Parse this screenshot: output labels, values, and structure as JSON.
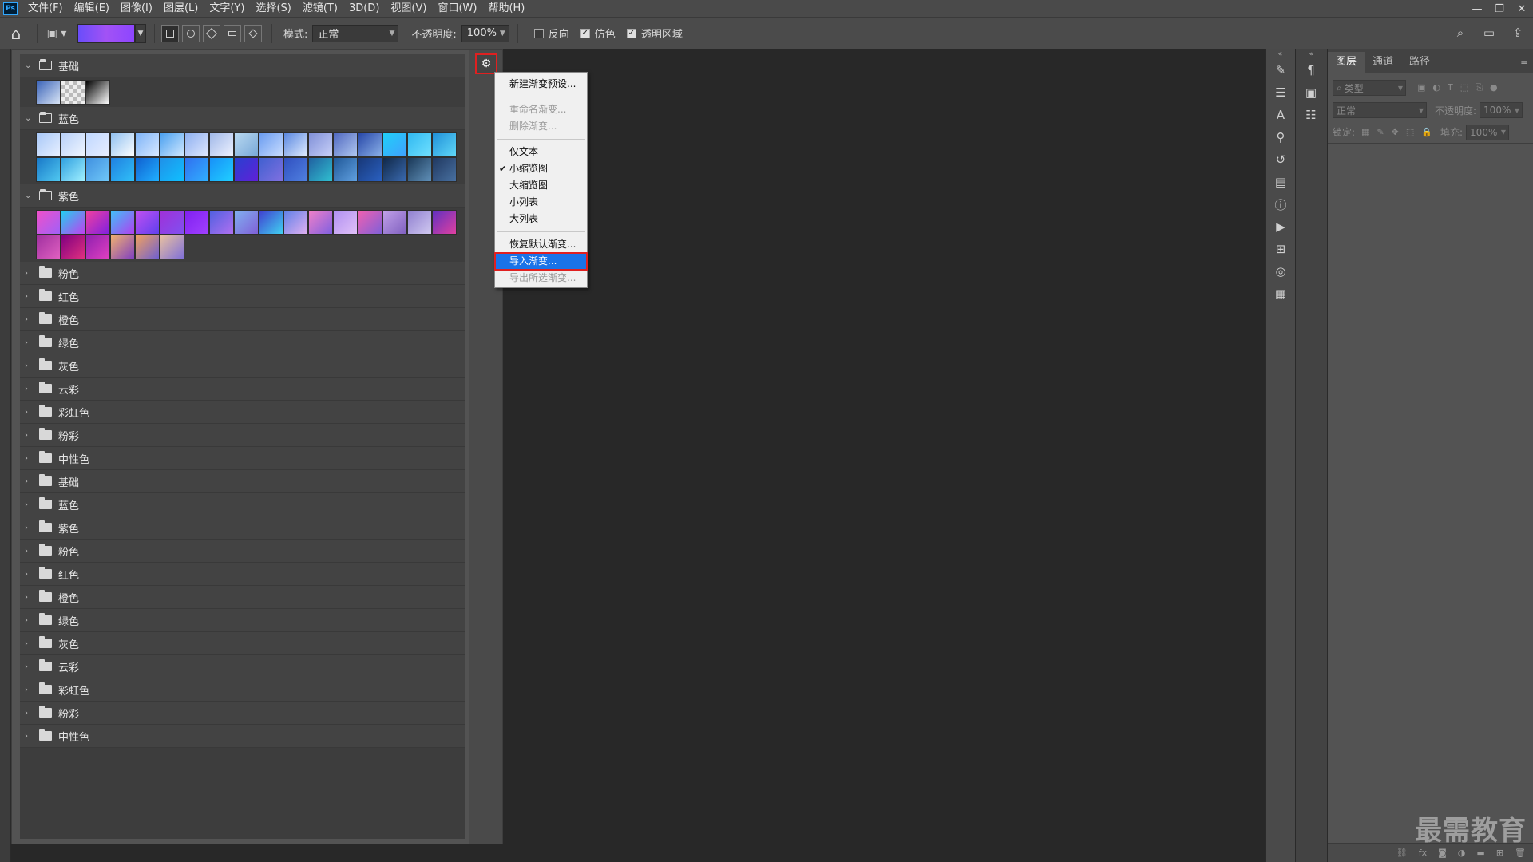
{
  "app": {
    "logo": "Ps"
  },
  "menu": [
    "文件(F)",
    "编辑(E)",
    "图像(I)",
    "图层(L)",
    "文字(Y)",
    "选择(S)",
    "滤镜(T)",
    "3D(D)",
    "视图(V)",
    "窗口(W)",
    "帮助(H)"
  ],
  "options": {
    "mode_label": "模式:",
    "mode_value": "正常",
    "opacity_label": "不透明度:",
    "opacity_value": "100%",
    "reverse_label": "反向",
    "reverse_checked": false,
    "dither_label": "仿色",
    "dither_checked": true,
    "transparency_label": "透明区域",
    "transparency_checked": true,
    "gradient_preview_colors": [
      "#6a4dfa",
      "#a252f5",
      "#8d46ff"
    ]
  },
  "gradient_panel": {
    "open_groups": [
      {
        "label": "基础",
        "swatches": [
          "linear-gradient(135deg,#3a63b8,#d8e4f5)",
          "repeating-conic-gradient(#bbb 0 25%, #eee 0 50%) 0 0/10px 10px",
          "linear-gradient(135deg,#000,#fff)"
        ]
      },
      {
        "label": "蓝色",
        "swatches": [
          "linear-gradient(135deg,#a8c8f8,#e8f0ff)",
          "linear-gradient(135deg,#b8d0f8,#f0f6ff)",
          "linear-gradient(135deg,#c0d8ff,#e8eeff)",
          "linear-gradient(135deg,#90c0f0,#ffffff)",
          "linear-gradient(135deg,#7eb4f8,#d8e8ff)",
          "linear-gradient(135deg,#4aa0f0,#d0e8ff)",
          "linear-gradient(135deg,#8eb0f0,#e0e8ff)",
          "linear-gradient(135deg,#a0b8e8,#eef2ff)",
          "linear-gradient(135deg,#b8d8f0,#78a8d8)",
          "linear-gradient(135deg,#6a9cf0,#c8dcff)",
          "linear-gradient(135deg,#5a88e0,#e0ecff)",
          "linear-gradient(135deg,#8090d8,#c8d0f8)",
          "linear-gradient(135deg,#5068c0,#b0c8f0)",
          "linear-gradient(135deg,#2848a8,#8ab0e8)",
          "linear-gradient(135deg,#20d0f8,#40a0ff)",
          "linear-gradient(135deg,#30b8f0,#70e0ff)",
          "linear-gradient(135deg,#2090d8,#60d8f8)",
          "linear-gradient(135deg,#1878c8,#50c8f0)",
          "linear-gradient(135deg,#30a0e0,#a0f0ff)",
          "linear-gradient(135deg,#4090e0,#70c8f8)",
          "linear-gradient(135deg,#2080e0,#30c0f8)",
          "linear-gradient(135deg,#1060d0,#20b0ff)",
          "linear-gradient(135deg,#2090e8,#10c0ff)",
          "linear-gradient(135deg,#3070f0,#30b0ff)",
          "linear-gradient(135deg,#1890f8,#20d0ff)",
          "linear-gradient(135deg,#2840d0,#6020d8)",
          "linear-gradient(135deg,#4060d0,#8070e0)",
          "linear-gradient(135deg,#3050c0,#5080e0)",
          "linear-gradient(135deg,#2060a0,#30c0d0)",
          "linear-gradient(135deg,#205898,#60a0e0)",
          "linear-gradient(135deg,#183878,#2a60c0)",
          "linear-gradient(135deg,#102848,#3a6ab0)",
          "linear-gradient(135deg,#1a3858,#6090b8)",
          "linear-gradient(135deg,#203860,#4870a0)"
        ]
      },
      {
        "label": "紫色",
        "swatches": [
          "linear-gradient(135deg,#f050c8,#a060f8)",
          "linear-gradient(135deg,#20d0f0,#c040f0)",
          "linear-gradient(135deg,#f040a0,#8020e0)",
          "linear-gradient(135deg,#40c0f8,#b040f0)",
          "linear-gradient(135deg,#c050f0,#6040f0)",
          "linear-gradient(135deg,#a030d8,#8050f0)",
          "linear-gradient(135deg,#8020f0,#a040ff)",
          "linear-gradient(135deg,#5060e0,#b070f0)",
          "linear-gradient(135deg,#80b0f0,#8060d8)",
          "linear-gradient(135deg,#4040d0,#40d0f0)",
          "linear-gradient(135deg,#6080e8,#e0b0f0)",
          "linear-gradient(135deg,#f080c8,#8060e0)",
          "linear-gradient(135deg,#b090f0,#e0c0f8)",
          "linear-gradient(135deg,#f060b0,#8060d8)",
          "linear-gradient(135deg,#c0a0e8,#8060c0)",
          "linear-gradient(135deg,#9080d0,#d0c8f0)",
          "linear-gradient(135deg,#6030c0,#e040a0)",
          "linear-gradient(135deg,#a030a0,#e060c0)",
          "linear-gradient(135deg,#800080,#e03080)",
          "linear-gradient(135deg,#9020b0,#e040c0)",
          "linear-gradient(135deg,#f0b070,#8040c0)",
          "linear-gradient(135deg,#f0a060,#7060d0)",
          "linear-gradient(135deg,#e8c0a0,#8070d8)"
        ]
      }
    ],
    "collapsed_groups": [
      "粉色",
      "红色",
      "橙色",
      "绿色",
      "灰色",
      "云彩",
      "彩虹色",
      "粉彩",
      "中性色",
      "基础",
      "蓝色",
      "紫色",
      "粉色",
      "红色",
      "橙色",
      "绿色",
      "灰色",
      "云彩",
      "彩虹色",
      "粉彩",
      "中性色"
    ]
  },
  "context_menu": {
    "items": [
      {
        "label": "新建渐变预设...",
        "disabled": false,
        "checked": false,
        "highlight": false,
        "sep_after": true
      },
      {
        "label": "重命名渐变...",
        "disabled": true,
        "checked": false,
        "highlight": false,
        "sep_after": false
      },
      {
        "label": "删除渐变...",
        "disabled": true,
        "checked": false,
        "highlight": false,
        "sep_after": true
      },
      {
        "label": "仅文本",
        "disabled": false,
        "checked": false,
        "highlight": false,
        "sep_after": false
      },
      {
        "label": "小缩览图",
        "disabled": false,
        "checked": true,
        "highlight": false,
        "sep_after": false
      },
      {
        "label": "大缩览图",
        "disabled": false,
        "checked": false,
        "highlight": false,
        "sep_after": false
      },
      {
        "label": "小列表",
        "disabled": false,
        "checked": false,
        "highlight": false,
        "sep_after": false
      },
      {
        "label": "大列表",
        "disabled": false,
        "checked": false,
        "highlight": false,
        "sep_after": true
      },
      {
        "label": "恢复默认渐变...",
        "disabled": false,
        "checked": false,
        "highlight": false,
        "sep_after": false
      },
      {
        "label": "导入渐变...",
        "disabled": false,
        "checked": false,
        "highlight": true,
        "sep_after": false
      },
      {
        "label": "导出所选渐变...",
        "disabled": true,
        "checked": false,
        "highlight": false,
        "sep_after": false
      }
    ]
  },
  "layers_panel": {
    "tabs": [
      "图层",
      "通道",
      "路径"
    ],
    "active_tab": 0,
    "filter_placeholder": "类型",
    "blend_mode": "正常",
    "opacity_label": "不透明度:",
    "lock_label": "锁定:",
    "fill_label": "填充:",
    "opacity_value": "100%",
    "fill_value": "100%"
  },
  "watermark": "最需教育"
}
